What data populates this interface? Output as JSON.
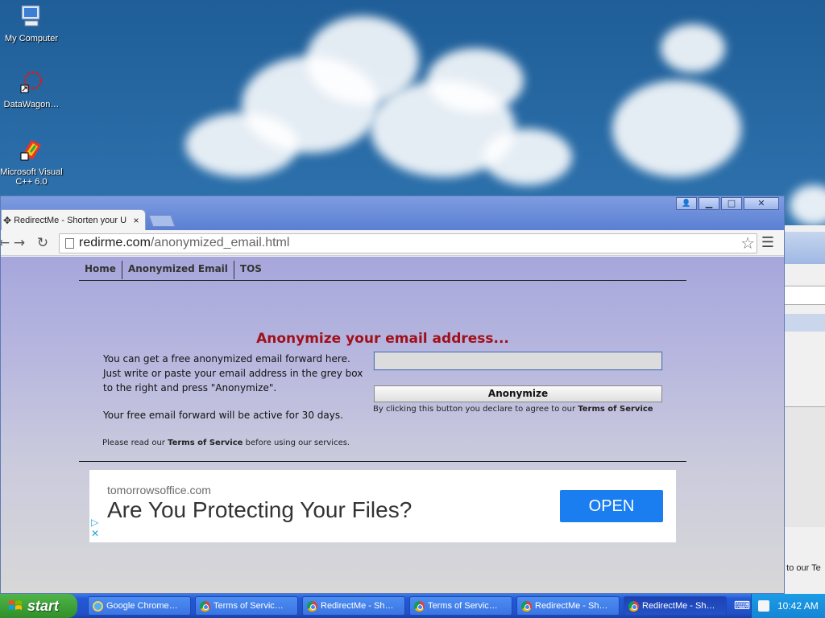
{
  "desktop": {
    "icons": [
      {
        "label": "My Computer",
        "icon": "computer-icon"
      },
      {
        "label": "DataWagon…",
        "icon": "datawagon-shortcut-icon"
      },
      {
        "label": "Microsoft Visual C++ 6.0",
        "icon": "visual-cpp-shortcut-icon"
      }
    ]
  },
  "background_window": {
    "partial_text": "e to our Te"
  },
  "browser": {
    "tab_title": "RedirectMe - Shorten your U",
    "tab_close": "×",
    "url_host": "redirme.com",
    "url_path": "/anonymized_email.html",
    "window_buttons": {
      "minimize": "▁",
      "maximize": "□",
      "close": "✕",
      "profile": "👤"
    }
  },
  "page": {
    "nav": [
      "Home",
      "Anonymized Email",
      "TOS"
    ],
    "heading": "Anonymize your email address...",
    "description": "You can get a free anonymized email forward here. Just write or paste your email address in the grey box to the right and press \"Anonymize\".",
    "active_note": "Your free email forward will be active for 30 days.",
    "read_prefix": "Please read our ",
    "read_link": "Terms of Service",
    "read_suffix": " before using our services.",
    "email_value": "",
    "button_label": "Anonymize",
    "agree_prefix": "By clicking this button you declare to agree to our ",
    "agree_link": "Terms of Service"
  },
  "ad": {
    "domain": "tomorrowsoffice.com",
    "headline": "Are You Protecting Your Files?",
    "cta": "OPEN",
    "choices_icon": "adchoices-icon",
    "close_glyph": "✕"
  },
  "taskbar": {
    "start_label": "start",
    "tasks": [
      {
        "label": "Google Chrome…",
        "icon": "ie-icon",
        "active": false
      },
      {
        "label": "Terms of Servic…",
        "icon": "chrome-icon",
        "active": false
      },
      {
        "label": "RedirectMe - Sh…",
        "icon": "chrome-icon",
        "active": false
      },
      {
        "label": "Terms of Servic…",
        "icon": "chrome-icon",
        "active": false
      },
      {
        "label": "RedirectMe - Sh…",
        "icon": "chrome-icon",
        "active": false
      },
      {
        "label": "RedirectMe - Sh…",
        "icon": "chrome-icon",
        "active": true
      }
    ],
    "clock": "10:42 AM"
  },
  "colors": {
    "heading": "#a0101a",
    "ad_cta": "#1a7ef0",
    "taskbar": "#2458d6",
    "start": "#3a9b35"
  }
}
